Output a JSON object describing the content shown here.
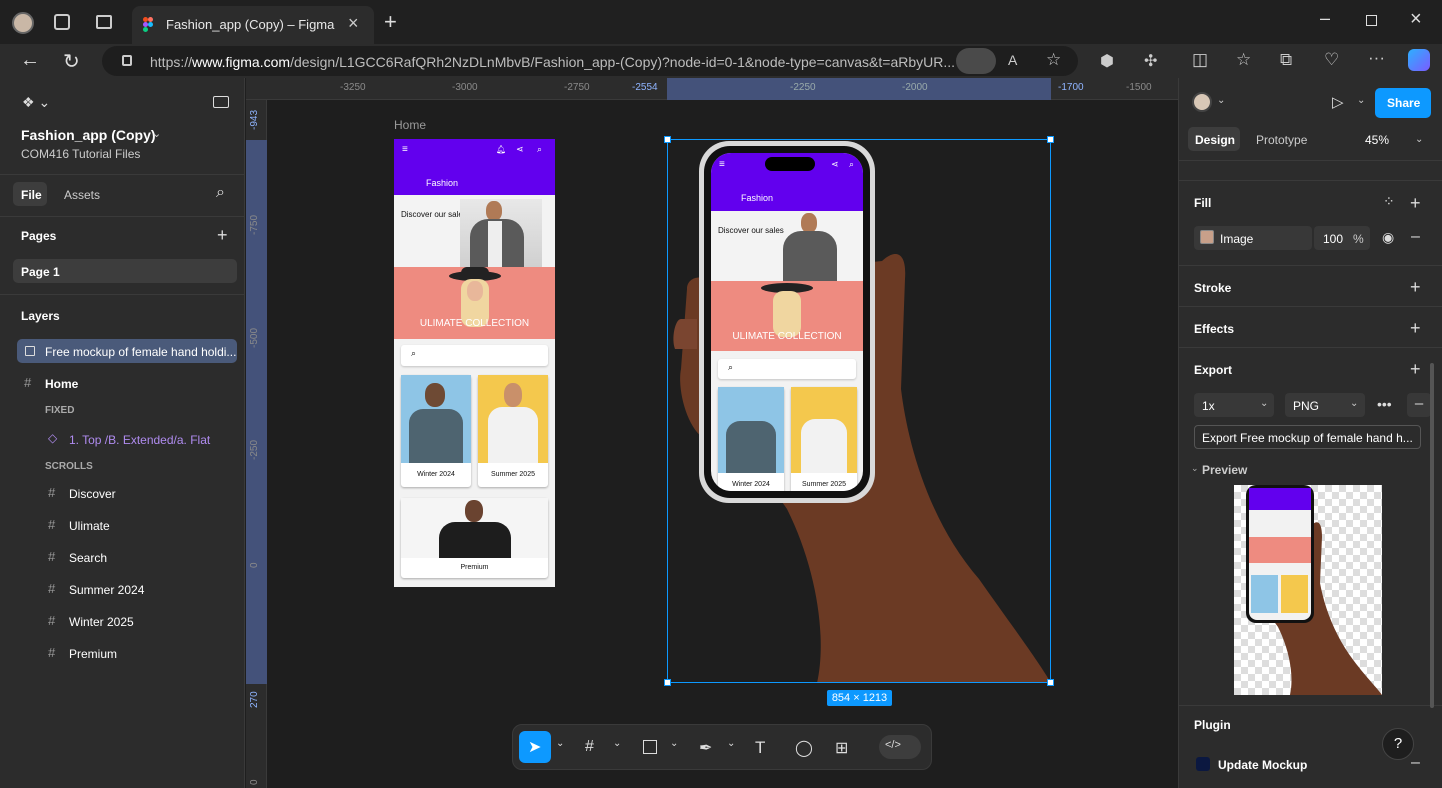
{
  "browser": {
    "tab_title": "Fashion_app (Copy) – Figma",
    "url_prefix": "https://",
    "url_host": "www.figma.com",
    "url_path": "/design/L1GCC6RafQRh2NzDLnMbvB/Fashion_app-(Copy)?node-id=0-1&node-type=canvas&t=aRbyUR..."
  },
  "left_panel": {
    "file_name": "Fashion_app (Copy)",
    "team": "COM416 Tutorial Files",
    "tabs": [
      "File",
      "Assets"
    ],
    "pages_label": "Pages",
    "page": "Page 1",
    "layers_label": "Layers",
    "selected_layer": "Free mockup of female hand holdi...",
    "home": "Home",
    "fixed_label": "FIXED",
    "fixed_item": "1. Top /B. Extended/a. Flat",
    "scrolls_label": "SCROLLS",
    "scroll_items": [
      "Discover",
      "Ulimate",
      "Search",
      "Summer 2024",
      "Winter 2025",
      "Premium"
    ]
  },
  "rulers": {
    "top": [
      "-3250",
      "-3000",
      "-2750",
      "-2554",
      "-2250",
      "-2000",
      "-1700",
      "-1500"
    ],
    "left": [
      "-943",
      "-750",
      "-500",
      "-250",
      "0",
      "270",
      "0"
    ]
  },
  "canvas": {
    "frame_label": "Home",
    "size_badge": "854 × 1213"
  },
  "app_screen": {
    "brand": "Fashion",
    "discover": "Discover our sales",
    "collection": "ULIMATE COLLECTION",
    "card1": "Winter 2024",
    "card2": "Summer 2025",
    "card3": "Premium"
  },
  "right_panel": {
    "tabs": [
      "Design",
      "Prototype"
    ],
    "zoom": "45%",
    "share": "Share",
    "fill_label": "Fill",
    "fill_type": "Image",
    "fill_opacity": "100",
    "percent": "%",
    "stroke_label": "Stroke",
    "effects_label": "Effects",
    "export_label": "Export",
    "export_scale": "1x",
    "export_format": "PNG",
    "export_button": "Export Free mockup of female hand h...",
    "preview_label": "Preview",
    "plugin_label": "Plugin",
    "plugin_item": "Update Mockup",
    "help": "?"
  },
  "colors": {
    "accent": "#0d99ff",
    "app_purple": "#6200ee",
    "collection_bg": "#ee8b80"
  }
}
